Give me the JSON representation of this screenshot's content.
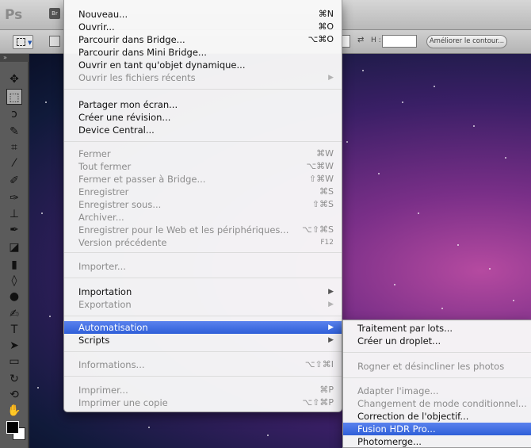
{
  "app": {
    "logo": "Ps",
    "bridge_badge": "Br"
  },
  "options_bar": {
    "height_label": "H :",
    "refine_edge": "Améliorer le contour..."
  },
  "menu": {
    "group1": [
      {
        "label": "Nouveau...",
        "shortcut": "⌘N",
        "disabled": false
      },
      {
        "label": "Ouvrir...",
        "shortcut": "⌘O",
        "disabled": false
      },
      {
        "label": "Parcourir dans Bridge...",
        "shortcut": "⌥⌘O",
        "disabled": false
      },
      {
        "label": "Parcourir dans Mini Bridge...",
        "shortcut": "",
        "disabled": false
      },
      {
        "label": "Ouvrir en tant qu'objet dynamique...",
        "shortcut": "",
        "disabled": false
      },
      {
        "label": "Ouvrir les fichiers récents",
        "shortcut": "",
        "disabled": true,
        "submenu": true
      }
    ],
    "group2": [
      {
        "label": "Partager mon écran...",
        "shortcut": ""
      },
      {
        "label": "Créer une révision...",
        "shortcut": ""
      },
      {
        "label": "Device Central...",
        "shortcut": ""
      }
    ],
    "group3": [
      {
        "label": "Fermer",
        "shortcut": "⌘W"
      },
      {
        "label": "Tout fermer",
        "shortcut": "⌥⌘W"
      },
      {
        "label": "Fermer et passer à Bridge...",
        "shortcut": "⇧⌘W"
      },
      {
        "label": "Enregistrer",
        "shortcut": "⌘S"
      },
      {
        "label": "Enregistrer sous...",
        "shortcut": "⇧⌘S"
      },
      {
        "label": "Archiver...",
        "shortcut": ""
      },
      {
        "label": "Enregistrer pour le Web et les périphériques...",
        "shortcut": "⌥⇧⌘S"
      },
      {
        "label": "Version précédente",
        "shortcut": "F12"
      }
    ],
    "group4": [
      {
        "label": "Importer...",
        "shortcut": ""
      }
    ],
    "group5": [
      {
        "label": "Importation",
        "disabled": false
      },
      {
        "label": "Exportation",
        "disabled": true
      }
    ],
    "group6": [
      {
        "label": "Automatisation",
        "highlighted": true
      },
      {
        "label": "Scripts",
        "highlighted": false
      }
    ],
    "group7": [
      {
        "label": "Informations...",
        "shortcut": "⌥⇧⌘I"
      }
    ],
    "group8": [
      {
        "label": "Imprimer...",
        "shortcut": "⌘P"
      },
      {
        "label": "Imprimer une copie",
        "shortcut": "⌥⇧⌘P"
      }
    ]
  },
  "submenu": {
    "items": [
      {
        "label": "Traitement par lots...",
        "disabled": false
      },
      {
        "label": "Créer un droplet...",
        "disabled": false
      },
      {
        "label": "Rogner et désincliner les photos",
        "disabled": true
      },
      {
        "label": "Adapter l'image...",
        "disabled": true
      },
      {
        "label": "Changement de mode conditionnel...",
        "disabled": true
      },
      {
        "label": "Correction de l'objectif...",
        "disabled": false
      },
      {
        "label": "Fusion HDR Pro...",
        "disabled": false,
        "highlighted": true
      },
      {
        "label": "Photomerge...",
        "disabled": false
      }
    ]
  }
}
